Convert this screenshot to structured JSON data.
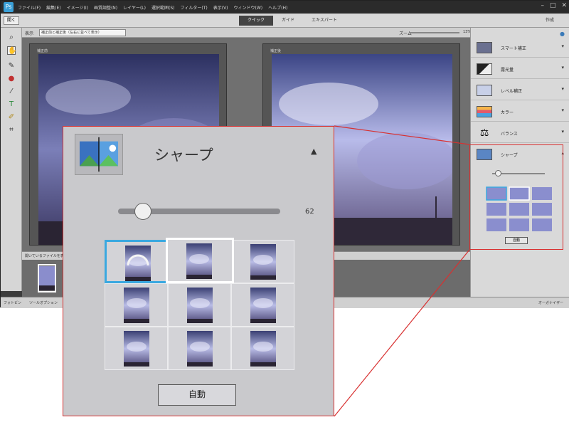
{
  "app": {
    "menu": [
      "ファイル(F)",
      "編集(E)",
      "イメージ(I)",
      "画質調整(N)",
      "レイヤー(L)",
      "選択範囲(S)",
      "フィルター(T)",
      "表示(V)",
      "ウィンドウ(W)",
      "ヘルプ(H)"
    ],
    "open_label": "開く",
    "modes": [
      "クイック",
      "ガイド",
      "エキスパート"
    ],
    "active_mode": "クイック",
    "create_label": "作成",
    "view_label": "表示",
    "view_select": "補正前と補正後（左右に並べて表示）",
    "zoom_label": "ズーム",
    "zoom_value": "13%",
    "before_label": "補正前",
    "after_label": "補正後",
    "photo_bin_label": "開いているファイルを表示",
    "taskbar": {
      "photo_bin": "フォトビン",
      "tool_options": "ツールオプション",
      "organizer": "オーガナイザー"
    }
  },
  "right_panel": {
    "items": [
      {
        "label": "スマート補正",
        "icon": "smart-fix-icon"
      },
      {
        "label": "露光量",
        "icon": "exposure-icon"
      },
      {
        "label": "レベル補正",
        "icon": "levels-icon"
      },
      {
        "label": "カラー",
        "icon": "color-icon"
      },
      {
        "label": "バランス",
        "icon": "balance-icon"
      },
      {
        "label": "シャープ",
        "icon": "sharpen-icon"
      }
    ],
    "auto_label": "自動"
  },
  "callout": {
    "title": "シャープ",
    "slider_value": "62",
    "slider_level": 0.1,
    "auto_label": "自動",
    "selected_index": 0,
    "hovered_index": 1
  },
  "colors": {
    "highlight": "#d83030",
    "selected": "#3aa8e0",
    "sky_dark": "#3a3f73",
    "sky_light": "#b9bce6"
  }
}
